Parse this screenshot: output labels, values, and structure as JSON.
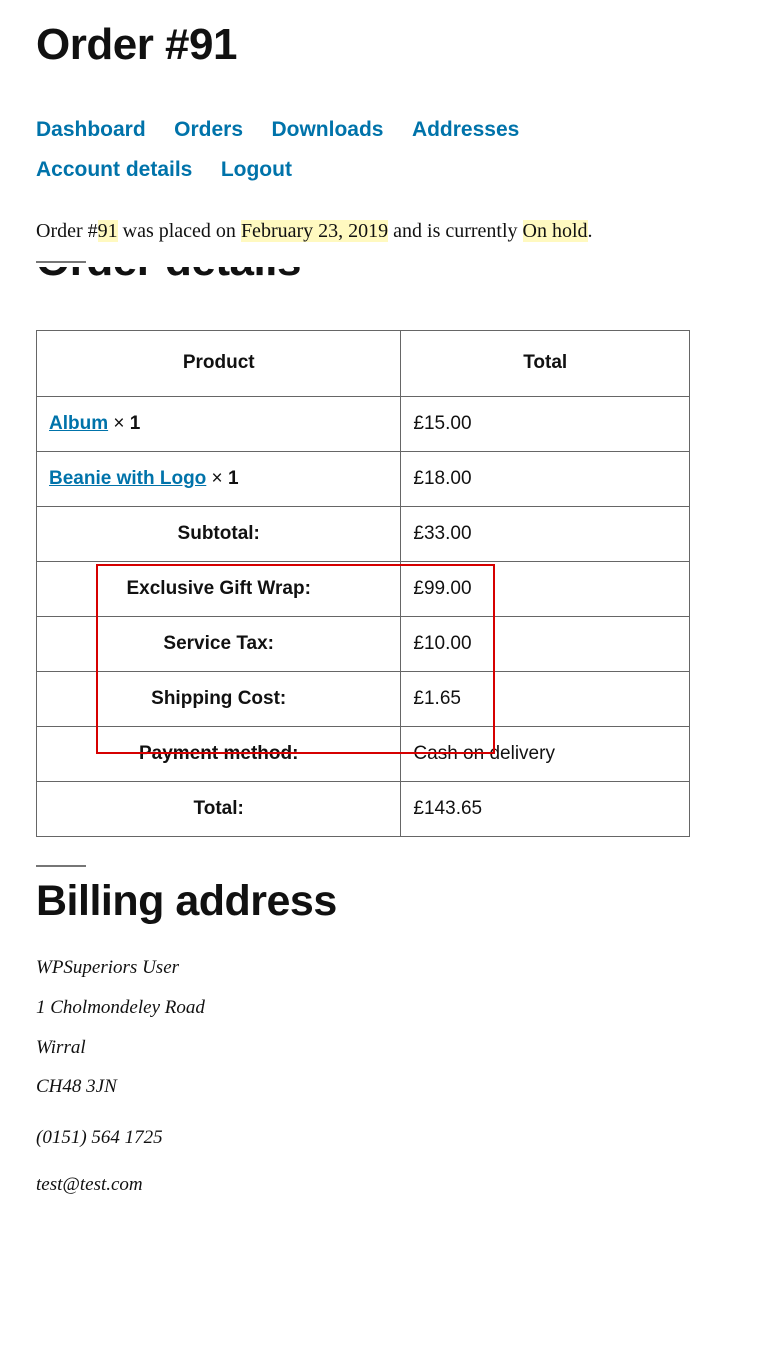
{
  "title": "Order #91",
  "nav": {
    "dashboard": "Dashboard",
    "orders": "Orders",
    "downloads": "Downloads",
    "addresses": "Addresses",
    "account_details": "Account details",
    "logout": "Logout"
  },
  "summary": {
    "prefix": "Order #",
    "order_no": "91",
    "placed_on": " was placed on ",
    "date": "February 23, 2019",
    "and_currently": " and is currently ",
    "status": "On hold",
    "period": "."
  },
  "order_details_heading": "Order details",
  "table": {
    "head_product": "Product",
    "head_total": "Total",
    "items": [
      {
        "name": "Album",
        "qty": "1",
        "total": "£15.00"
      },
      {
        "name": "Beanie with Logo",
        "qty": "1",
        "total": "£18.00"
      }
    ],
    "rows": [
      {
        "label": "Subtotal:",
        "value": "£33.00"
      },
      {
        "label": "Exclusive Gift Wrap:",
        "value": "£99.00"
      },
      {
        "label": "Service Tax:",
        "value": "£10.00"
      },
      {
        "label": "Shipping Cost:",
        "value": "£1.65"
      },
      {
        "label": "Payment method:",
        "value": "Cash on delivery"
      },
      {
        "label": "Total:",
        "value": "£143.65"
      }
    ],
    "x_symbol": " × "
  },
  "billing_heading": "Billing address",
  "billing": {
    "name": "WPSuperiors User",
    "line1": "1 Cholmondeley Road",
    "city": "Wirral",
    "postcode": "CH48 3JN",
    "phone": "(0151) 564 1725",
    "email": "test@test.com"
  }
}
